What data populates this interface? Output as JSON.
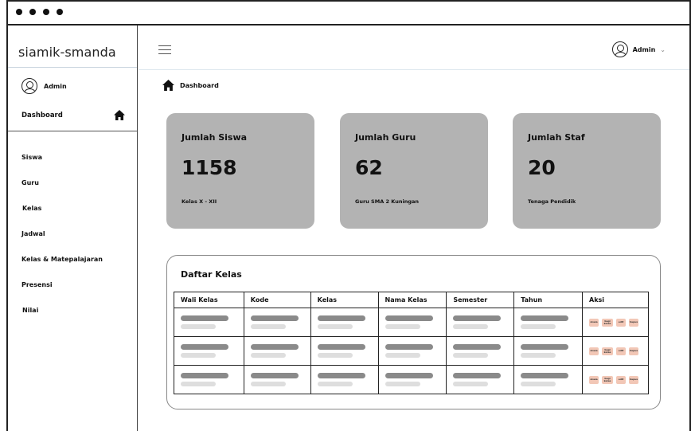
{
  "window": {
    "dots": 4
  },
  "sidebar": {
    "brand": "siamik-smanda",
    "user_label": "Admin",
    "dashboard_label": "Dashboard",
    "items": [
      {
        "label": "Siswa"
      },
      {
        "label": "Guru"
      },
      {
        "label": "Kelas"
      },
      {
        "label": "Jadwal"
      },
      {
        "label": "Kelas & Matepalajaran"
      },
      {
        "label": "Presensi"
      },
      {
        "label": "Nilai"
      }
    ]
  },
  "header": {
    "user_label": "Admin",
    "caret": "⌄"
  },
  "breadcrumb": {
    "label": "Dashboard"
  },
  "cards": [
    {
      "title": "Jumlah Siswa",
      "value": "1158",
      "sub": "Kelas X - XII"
    },
    {
      "title": "Jumlah Guru",
      "value": "62",
      "sub": "Guru SMA 2 Kuningan"
    },
    {
      "title": "Jumlah Staf",
      "value": "20",
      "sub": "Tenaga Pendidik"
    }
  ],
  "panel": {
    "title": "Daftar Kelas",
    "columns": [
      "Wali Kelas",
      "Kode",
      "Kelas",
      "Nama Kelas",
      "Semester",
      "Tahun",
      "Aksi"
    ],
    "row_count": 3,
    "actions": [
      {
        "label": "siswa"
      },
      {
        "label": "bagi kelas"
      },
      {
        "label": "edit"
      },
      {
        "label": "hapus"
      }
    ]
  },
  "colors": {
    "card_bg": "#b3b3b3",
    "action_bg": "#f2c7b6",
    "placeholder_dark": "#8a8a8a",
    "placeholder_light": "#dedede"
  }
}
